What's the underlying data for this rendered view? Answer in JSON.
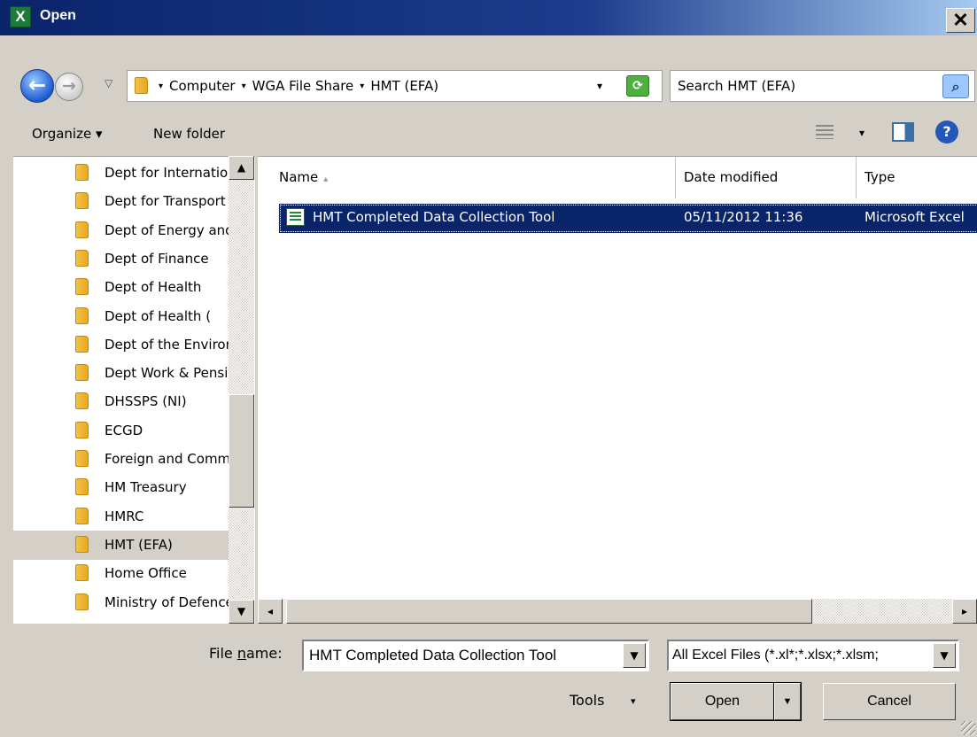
{
  "window": {
    "title": "Open",
    "app_icon": "excel-icon",
    "close_label": "✕"
  },
  "navigation": {
    "back_icon": "back-arrow-icon",
    "forward_icon": "forward-arrow-icon",
    "recent_dropdown": "▽"
  },
  "address": {
    "crumbs": [
      "Computer",
      "WGA File Share",
      "HMT (EFA)"
    ],
    "separator": "▾",
    "dropdown": "▾",
    "refresh_icon": "refresh-icon"
  },
  "search": {
    "placeholder": "Search HMT (EFA)",
    "icon": "search-icon"
  },
  "toolbar": {
    "organize_label": "Organize ▾",
    "new_folder_label": "New folder",
    "view_dropdown": "▾",
    "help_label": "?"
  },
  "tree": {
    "items": [
      {
        "label": "Dept for Internationa",
        "selected": false
      },
      {
        "label": "Dept for Transport",
        "selected": false
      },
      {
        "label": "Dept of Energy and",
        "selected": false
      },
      {
        "label": "Dept of Finance",
        "selected": false
      },
      {
        "label": "Dept of Health",
        "selected": false
      },
      {
        "label": "Dept of Health (",
        "selected": false
      },
      {
        "label": "Dept of the Environ",
        "selected": false
      },
      {
        "label": "Dept Work & Pensions",
        "selected": false
      },
      {
        "label": "DHSSPS (NI)",
        "selected": false
      },
      {
        "label": "ECGD",
        "selected": false
      },
      {
        "label": "Foreign and Commonwealth",
        "selected": false
      },
      {
        "label": "HM Treasury",
        "selected": false
      },
      {
        "label": "HMRC",
        "selected": false
      },
      {
        "label": "HMT (EFA)",
        "selected": true
      },
      {
        "label": "Home Office",
        "selected": false
      },
      {
        "label": "Ministry of Defence",
        "selected": false
      }
    ],
    "scroll_up": "▲",
    "scroll_down": "▼"
  },
  "file_list": {
    "columns": [
      {
        "label": "Name",
        "sort": "▴"
      },
      {
        "label": "Date modified"
      },
      {
        "label": "Type"
      }
    ],
    "rows": [
      {
        "name": "HMT Completed Data Collection Tool",
        "date": "05/11/2012 11:36",
        "type": "Microsoft Excel",
        "selected": true
      }
    ],
    "scroll_left": "◂",
    "scroll_right": "▸"
  },
  "footer": {
    "file_name_label_pre": "File ",
    "file_name_label_accel": "n",
    "file_name_label_post": "ame:",
    "file_name_value": "HMT Completed Data Collection Tool",
    "file_type_value": "All Excel Files (*.xl*;*.xlsx;*.xlsm;",
    "combo_arrow": "▼",
    "tools_label": "Tools",
    "tools_dropdown": "▾",
    "open_label": "Open",
    "open_dropdown": "▼",
    "cancel_label": "Cancel"
  }
}
